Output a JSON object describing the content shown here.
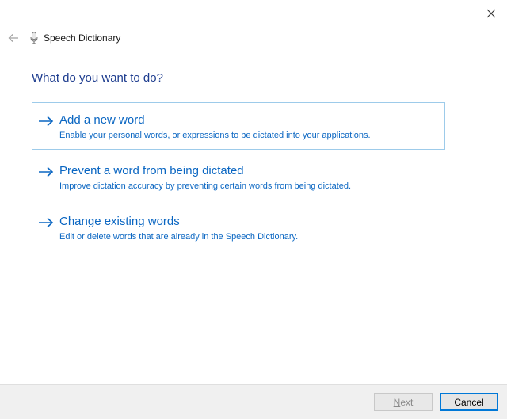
{
  "window": {
    "title": "Speech Dictionary"
  },
  "main": {
    "heading": "What do you want to do?",
    "options": [
      {
        "title": "Add a new word",
        "description": "Enable your personal words, or expressions to be dictated into your applications."
      },
      {
        "title": "Prevent a word from being dictated",
        "description": "Improve dictation accuracy by preventing certain words from being dictated."
      },
      {
        "title": "Change existing words",
        "description": "Edit or delete words that are already in the Speech Dictionary."
      }
    ]
  },
  "footer": {
    "next_label": "Next",
    "cancel_label": "Cancel"
  },
  "icons": {
    "close": "close-icon",
    "back": "back-arrow-icon",
    "app": "microphone-icon",
    "option_arrow": "right-arrow-icon"
  },
  "colors": {
    "accent": "#0a66c2",
    "heading": "#1e3d8f",
    "focus_border": "#9dcbea",
    "footer_bg": "#f0f0f0"
  }
}
